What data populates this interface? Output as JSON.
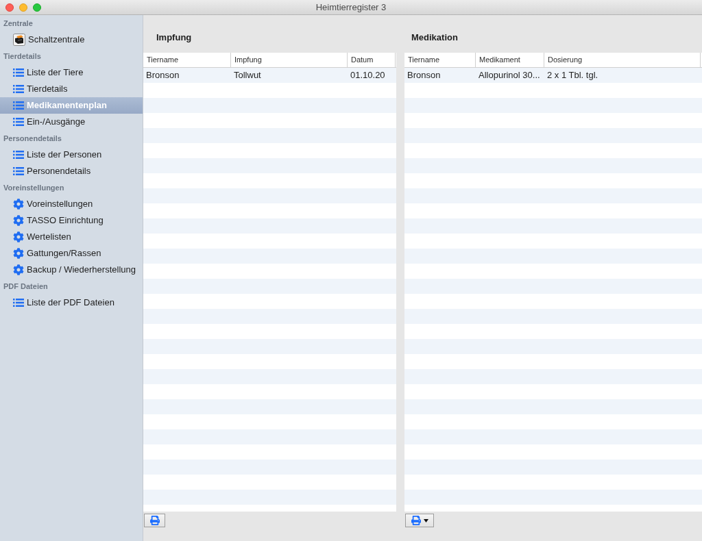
{
  "window": {
    "title": "Heimtierregister 3"
  },
  "sidebar": {
    "sections": [
      {
        "title": "Zentrale",
        "items": [
          {
            "label": "Schaltzentrale",
            "kind": "box",
            "selected": false
          }
        ]
      },
      {
        "title": "Tierdetails",
        "items": [
          {
            "label": "Liste der Tiere",
            "kind": "list",
            "selected": false
          },
          {
            "label": "Tierdetails",
            "kind": "list",
            "selected": false
          },
          {
            "label": "Medikamentenplan",
            "kind": "list",
            "selected": true
          },
          {
            "label": "Ein-/Ausgänge",
            "kind": "list",
            "selected": false
          }
        ]
      },
      {
        "title": "Personendetails",
        "items": [
          {
            "label": "Liste der Personen",
            "kind": "list",
            "selected": false
          },
          {
            "label": "Personendetails",
            "kind": "list",
            "selected": false
          }
        ]
      },
      {
        "title": "Voreinstellungen",
        "items": [
          {
            "label": "Voreinstellungen",
            "kind": "gear",
            "selected": false
          },
          {
            "label": "TASSO Einrichtung",
            "kind": "gear",
            "selected": false
          },
          {
            "label": "Wertelisten",
            "kind": "gear",
            "selected": false
          },
          {
            "label": "Gattungen/Rassen",
            "kind": "gear",
            "selected": false
          },
          {
            "label": "Backup / Wiederherstellung",
            "kind": "gear",
            "selected": false
          }
        ]
      },
      {
        "title": "PDF Dateien",
        "items": [
          {
            "label": "Liste der PDF Dateien",
            "kind": "list",
            "selected": false
          }
        ]
      }
    ]
  },
  "panels": [
    {
      "title": "Impfung",
      "table": {
        "columns": [
          "Tiername",
          "Impfung",
          "Datum"
        ],
        "rows": [
          [
            "Bronson",
            "Tollwut",
            "01.10.20"
          ]
        ]
      },
      "print_button": {
        "menu": false
      }
    },
    {
      "title": "Medikation",
      "table": {
        "columns": [
          "Tiername",
          "Medikament",
          "Dosierung"
        ],
        "rows": [
          [
            "Bronson",
            "Allopurinol 30...",
            "2 x 1 Tbl. tgl."
          ]
        ]
      },
      "print_button": {
        "menu": true
      }
    }
  ]
}
